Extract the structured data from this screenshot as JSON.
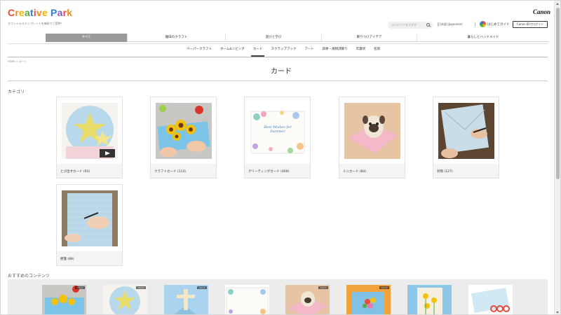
{
  "header": {
    "logo_letters": [
      "C",
      "r",
      "e",
      "a",
      "t",
      "i",
      "v",
      "e",
      " ",
      "P",
      "a",
      "r",
      "k"
    ],
    "logo_colors": [
      "#e94b3c",
      "#f08a1d",
      "#f2b400",
      "#5aa84a",
      "#2a7fd6",
      "#e94b3c",
      "#f08a1d",
      "#f2b400",
      "#ffffff",
      "#2a7fd6",
      "#8b57c8",
      "#e94b3c",
      "#f08a1d"
    ],
    "tagline": "オフィシャルテンプレートを無料でご提供！",
    "brand": "Canon",
    "search_placeholder": "コンテンツをさがす",
    "language": "日本語 (Japanese)",
    "guide_label": "はじめてガイド",
    "login_label": "Canon IDでログイン"
  },
  "nav_main": [
    "すべて",
    "趣味のクラフト",
    "遊びと学び",
    "飾りつけアイデア",
    "暮らしとハンドメイド"
  ],
  "nav_sub": [
    "ペーパークラフト",
    "ホーム&リビング",
    "カード",
    "スクラップブック",
    "アート",
    "四季・風物詩飾り",
    "年賀状",
    "名刺"
  ],
  "breadcrumb": "HOME > カード",
  "page_title": "カード",
  "category_title": "カテゴリ",
  "categories": [
    {
      "label": "とび出すカード (93)"
    },
    {
      "label": "クラフトカード (114)"
    },
    {
      "label": "グリーティングカード (469)"
    },
    {
      "label": "ミニカード (84)"
    },
    {
      "label": "封筒 (127)"
    },
    {
      "label": "便箋 (88)"
    }
  ],
  "recommend_title": "おすすめのコンテンツ",
  "thumb_tags": [
    "Canon",
    "Canon",
    "Canon",
    "",
    "Canon",
    "Canon",
    "",
    ""
  ],
  "greeting_text": "Best Wishes for Summer",
  "colors": {
    "accent_gray": "#9a9a9a",
    "active_tab_text": "#ffffff"
  }
}
